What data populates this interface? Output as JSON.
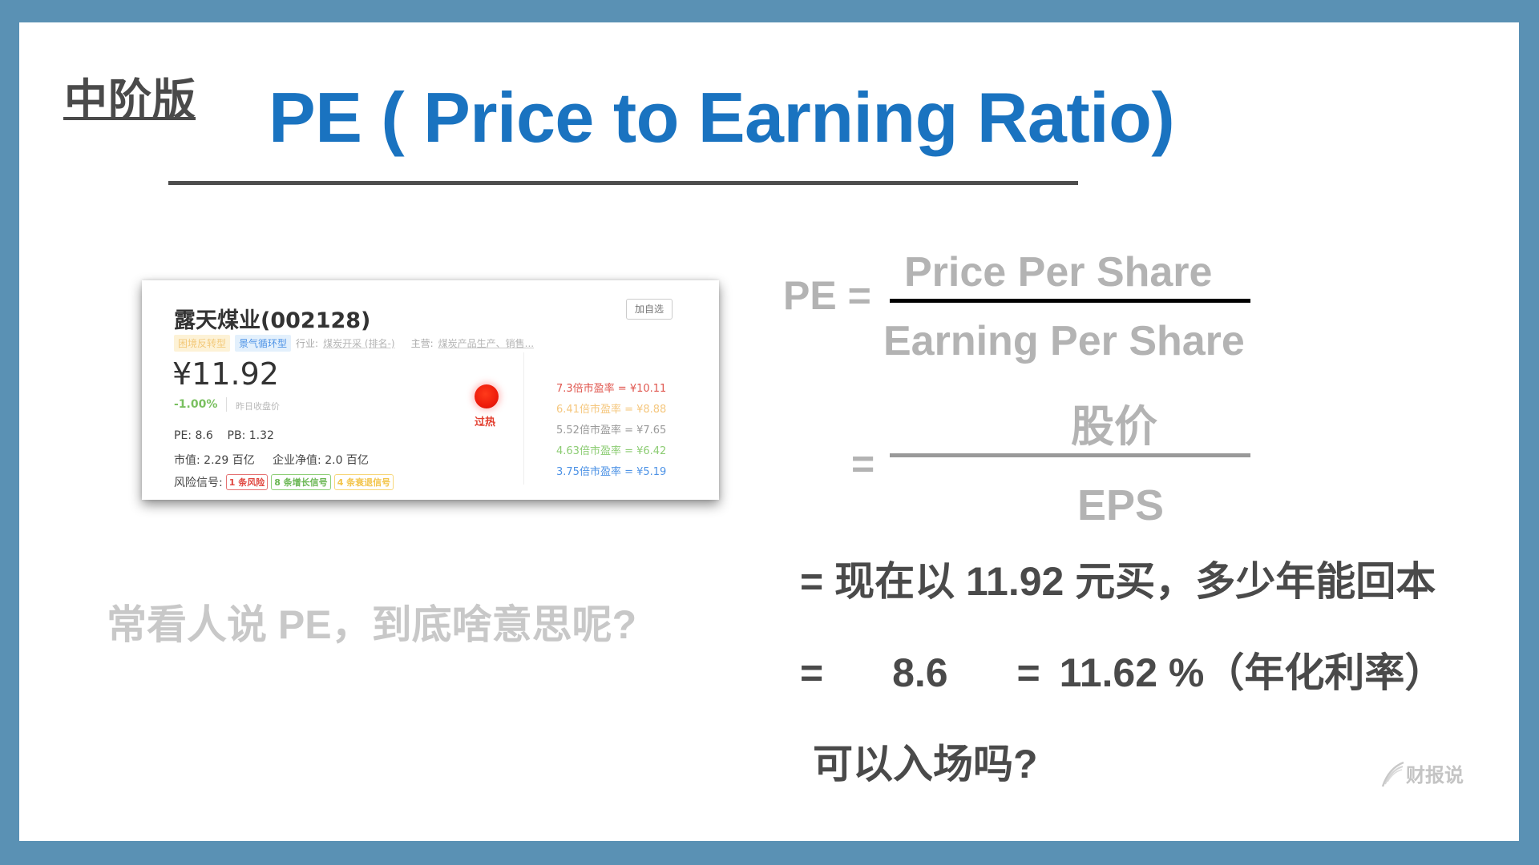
{
  "header": {
    "level_label": "中阶版",
    "title": "PE ( Price to Earning Ratio)"
  },
  "stock_card": {
    "name": "露天煤业(002128)",
    "add_watchlist_label": "加自选",
    "type_tags": [
      "困境反转型",
      "景气循环型"
    ],
    "industry_label": "行业:",
    "industry_value": "煤炭开采 (排名-)",
    "business_label": "主营:",
    "business_value": "煤炭产品生产、销售...",
    "price": "¥11.92",
    "change": "-1.00%",
    "close_label": "昨日收盘价",
    "pe_pb": "PE: 8.6    PB: 1.32",
    "market_cap": "市值: 2.29 百亿     企业净值: 2.0 百亿",
    "risk_label": "风险信号:",
    "signals": [
      {
        "label": "1 条风险",
        "color": "red"
      },
      {
        "label": "8 条增长信号",
        "color": "green"
      },
      {
        "label": "4 条衰退信号",
        "color": "yellow"
      }
    ],
    "status_label": "过热",
    "valuations": [
      {
        "label": "7.3倍市盈率 = ¥10.11",
        "color": "#e0574f"
      },
      {
        "label": "6.41倍市盈率 = ¥8.88",
        "color": "#f5c77e"
      },
      {
        "label": "5.52倍市盈率 = ¥7.65",
        "color": "#9a9a9a"
      },
      {
        "label": "4.63倍市盈率 = ¥6.42",
        "color": "#8ccc73"
      },
      {
        "label": "3.75倍市盈率 = ¥5.19",
        "color": "#4e93e6"
      }
    ]
  },
  "question": "常看人说 PE，到底啥意思呢?",
  "formula": {
    "lhs": "PE =",
    "numerator_en": "Price Per Share",
    "denominator_en": "Earning Per Share",
    "equals": "=",
    "numerator_cn": "股价",
    "denominator_abbr": "EPS"
  },
  "explanation": {
    "line1": "= 现在以 11.92 元买，多少年能回本",
    "line2_eq": "=",
    "line2_pe": "8.6",
    "line2_eq2": "=",
    "line2_rate": "11.62 %（年化利率）",
    "line3": "可以入场吗?"
  },
  "watermark": {
    "text": "财报说"
  },
  "colors": {
    "frame": "#5a91b4",
    "title": "#1a73c0",
    "body_text": "#4a4a4a",
    "muted_text": "#b3b3b3"
  }
}
